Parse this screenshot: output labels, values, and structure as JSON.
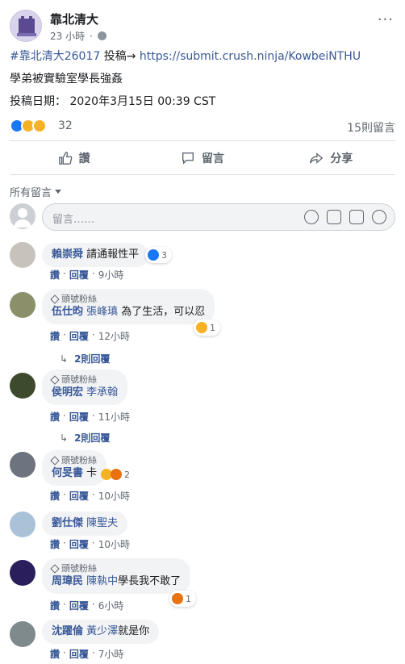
{
  "post": {
    "page_name": "靠北清大",
    "time": "23 小時",
    "line1_hashtag": "#靠北清大26017",
    "line1_text": " 投稿→ ",
    "line1_link": "https://submit.crush.ninja/KowbeiNTHU",
    "line2": "學弟被實驗室學長強姦",
    "line3": "投稿日期： 2020年3月15日 00:39 CST",
    "reaction_count": "32",
    "comment_count": "15則留言",
    "more": "···"
  },
  "actions": {
    "like": "讚",
    "comment": "留言",
    "share": "分享"
  },
  "sort": {
    "label": "所有留言"
  },
  "composer": {
    "placeholder": "留言……"
  },
  "comments": [
    {
      "author": "賴崇舜",
      "tag": "",
      "text": "請通報性平",
      "badge": "",
      "like": "讚",
      "reply": "回覆",
      "time": "9小時",
      "reactions": "3",
      "replies": ""
    },
    {
      "author": "伍仕昀",
      "tag": "張峰瑱",
      "text": " 為了生活，可以忍",
      "badge": "頭號粉絲",
      "like": "讚",
      "reply": "回覆",
      "time": "12小時",
      "reactions": "1",
      "replies": "2則回覆"
    },
    {
      "author": "侯明宏",
      "tag": "李承翰",
      "text": "",
      "badge": "頭號粉絲",
      "like": "讚",
      "reply": "回覆",
      "time": "11小時",
      "reactions": "",
      "replies": "2則回覆"
    },
    {
      "author": "何旻書",
      "tag": "",
      "text": "卡",
      "badge": "頭號粉絲",
      "like": "讚",
      "reply": "回覆",
      "time": "10小時",
      "reactions": "2",
      "replies": ""
    },
    {
      "author": "劉仕傑",
      "tag": "陳聖夫",
      "text": "",
      "badge": "",
      "like": "讚",
      "reply": "回覆",
      "time": "10小時",
      "reactions": "",
      "replies": ""
    },
    {
      "author": "周瑋民",
      "tag": "陳執中",
      "text": "學長我不敢了",
      "badge": "頭號粉絲",
      "like": "讚",
      "reply": "回覆",
      "time": "6小時",
      "reactions": "1",
      "replies": ""
    },
    {
      "author": "沈躍倫",
      "tag": "黃少澤",
      "text": "就是你",
      "badge": "",
      "like": "讚",
      "reply": "回覆",
      "time": "7小時",
      "reactions": "",
      "replies": ""
    }
  ],
  "colors": {
    "link": "#385898",
    "meta": "#606770",
    "bubble": "#f2f3f5",
    "like": "#1877f2",
    "wow": "#f7b125",
    "angry": "#e9710f"
  }
}
